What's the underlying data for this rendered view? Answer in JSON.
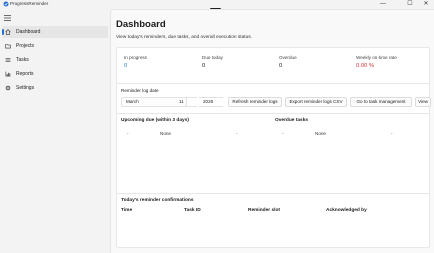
{
  "window": {
    "title": "ProgressReminder",
    "minimize": "—",
    "maximize": "☐",
    "close": "✕"
  },
  "sidebar": {
    "items": [
      {
        "label": "Dashboard",
        "icon": "home-icon",
        "active": true
      },
      {
        "label": "Projects",
        "icon": "folder-icon",
        "active": false
      },
      {
        "label": "Tasks",
        "icon": "list-icon",
        "active": false
      },
      {
        "label": "Reports",
        "icon": "chart-icon",
        "active": false
      },
      {
        "label": "Settings",
        "icon": "gear-icon",
        "active": false
      }
    ]
  },
  "page": {
    "title": "Dashboard",
    "subtitle": "View today's reminders, due tasks, and overall execution status."
  },
  "stats": [
    {
      "label": "In progress",
      "value": "0",
      "color": "#2b7fd8"
    },
    {
      "label": "Due today",
      "value": "0",
      "color": "#1b1b1b"
    },
    {
      "label": "Overdue",
      "value": "0",
      "color": "#1b1b1b"
    },
    {
      "label": "Weekly on-time rate",
      "value": "0.00 %",
      "color": "#d13438"
    }
  ],
  "reminder_log": {
    "label": "Reminder log date",
    "month": "March",
    "day": "11",
    "year": "2026",
    "refresh_button": "Refresh reminder logs",
    "export_button": "Export reminder logs CSV",
    "goto_button": "Go to task management",
    "view_button": "View"
  },
  "upcoming": {
    "title": "Upcoming due (within 3 days)",
    "row": {
      "col1": "-",
      "col2": "None",
      "col3": "-"
    }
  },
  "overdue_tasks": {
    "title": "Overdue tasks",
    "row": {
      "col1": "-",
      "col2": "None",
      "col3": "-"
    }
  },
  "confirmations": {
    "title": "Today's reminder confirmations",
    "columns": [
      "Time",
      "Task ID",
      "Reminder slot",
      "Acknowledged by"
    ]
  },
  "colors": {
    "accent": "#2b6fd1",
    "in_progress": "#2b7fd8",
    "rate": "#d13438"
  }
}
